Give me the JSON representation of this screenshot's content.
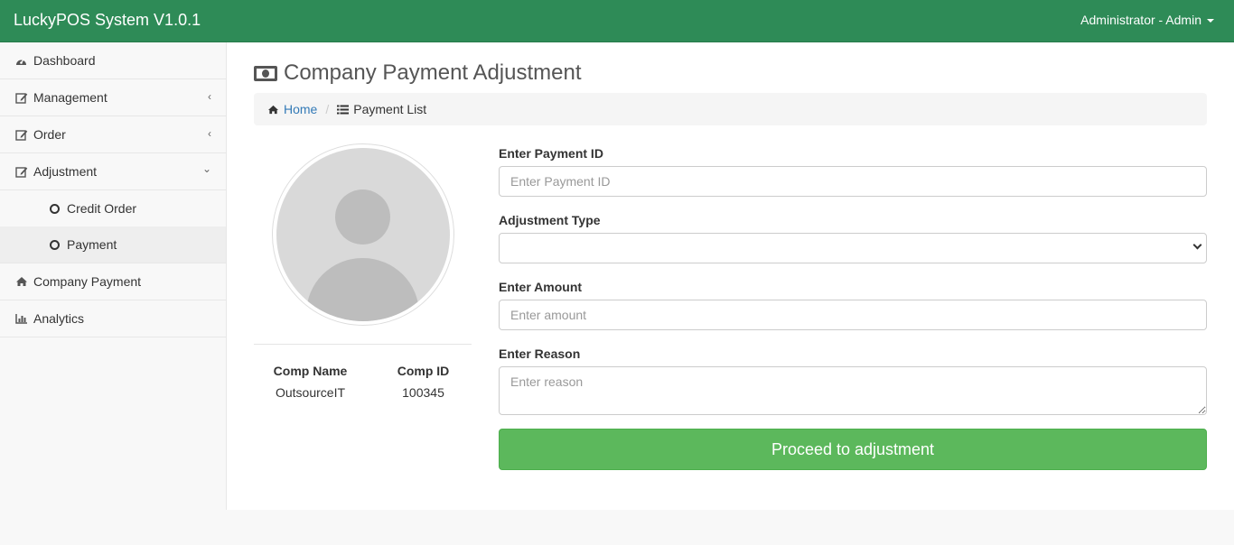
{
  "app": {
    "title": "LuckyPOS System V1.0.1",
    "user": "Administrator - Admin"
  },
  "sidebar": {
    "items": [
      {
        "label": "Dashboard",
        "icon": "dashboard-icon"
      },
      {
        "label": "Management",
        "icon": "edit-icon",
        "expanded": false
      },
      {
        "label": "Order",
        "icon": "edit-icon",
        "expanded": false
      },
      {
        "label": "Adjustment",
        "icon": "edit-icon",
        "expanded": true,
        "children": [
          {
            "label": "Credit Order",
            "active": false
          },
          {
            "label": "Payment",
            "active": true
          }
        ]
      },
      {
        "label": "Company Payment",
        "icon": "home-icon"
      },
      {
        "label": "Analytics",
        "icon": "bar-chart-icon"
      }
    ]
  },
  "page": {
    "title": "Company Payment Adjustment",
    "breadcrumb": {
      "home": "Home",
      "current": "Payment List"
    }
  },
  "company": {
    "name_label": "Comp Name",
    "id_label": "Comp ID",
    "name": "OutsourceIT",
    "id": "100345"
  },
  "form": {
    "payment_id_label": "Enter Payment ID",
    "payment_id_placeholder": "Enter Payment ID",
    "adjustment_type_label": "Adjustment Type",
    "adjustment_type_value": "",
    "amount_label": "Enter Amount",
    "amount_placeholder": "Enter amount",
    "reason_label": "Enter Reason",
    "reason_placeholder": "Enter reason",
    "submit_label": "Proceed to adjustment"
  },
  "colors": {
    "navbar": "#2e8b57",
    "button": "#5cb85c",
    "link": "#337ab7"
  }
}
